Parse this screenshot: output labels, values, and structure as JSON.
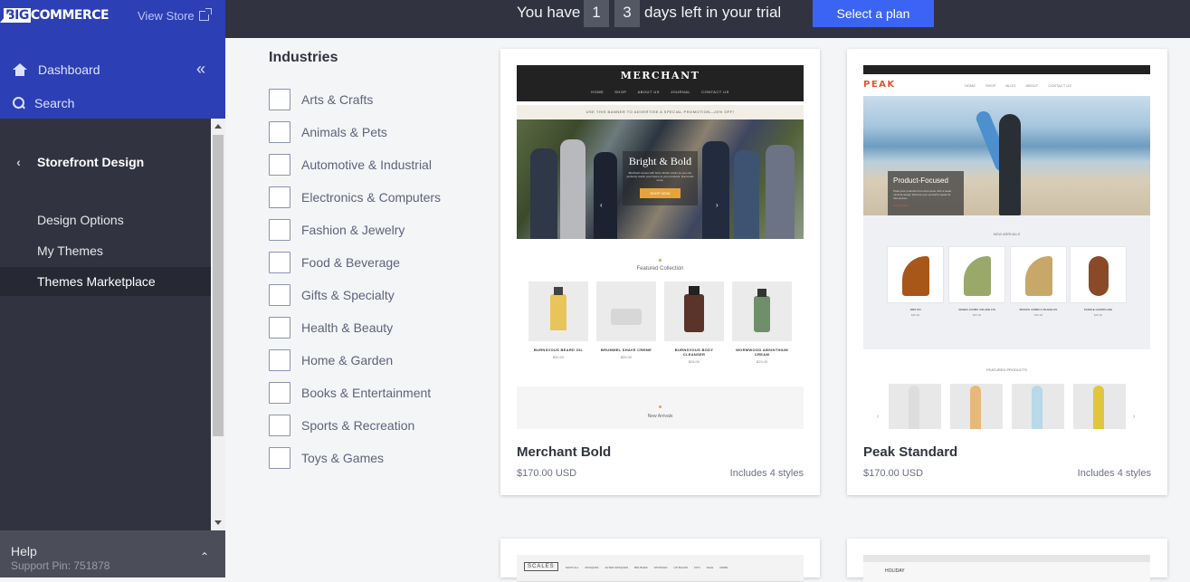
{
  "sidebar": {
    "logo_prefix": "BIG",
    "logo_suffix": "COMMERCE",
    "view_store": "View Store",
    "dashboard": "Dashboard",
    "search": "Search",
    "section": "Storefront Design",
    "links": [
      "Design Options",
      "My Themes",
      "Themes Marketplace"
    ],
    "active_link": "Themes Marketplace",
    "help": "Help",
    "support_pin": "Support Pin: 751878"
  },
  "trial": {
    "text_before": "You have",
    "digit1": "1",
    "digit2": "3",
    "text_after": "days left in your trial",
    "button": "Select a plan"
  },
  "filters": {
    "title": "Industries",
    "items": [
      "Arts & Crafts",
      "Animals & Pets",
      "Automotive & Industrial",
      "Electronics & Computers",
      "Fashion & Jewelry",
      "Food & Beverage",
      "Gifts & Specialty",
      "Health & Beauty",
      "Home & Garden",
      "Books & Entertainment",
      "Sports & Recreation",
      "Toys & Games"
    ]
  },
  "themes": [
    {
      "name": "Merchant Bold",
      "price": "$170.00 USD",
      "styles": "Includes 4 styles",
      "preview": {
        "logo": "MERCHANT",
        "nav": [
          "HOME",
          "SHOP",
          "ABOUT US",
          "JOURNAL",
          "CONTACT US"
        ],
        "promo": "USE THIS BANNER TO ADVERTISE A SPECIAL PROMOTION—20% OFF!",
        "hero_title": "Bright & Bold",
        "hero_sub": "Merchant comes with bold, vibrant colors so you can perfectly match your theme to your products, brand and more.",
        "hero_button": "SHOP NOW",
        "featured_title": "Featured Collection",
        "products": [
          {
            "name": "BURNSVOUS BEARD OIL",
            "price": "$30.00"
          },
          {
            "name": "BRUMMEL SHAVE CREME",
            "price": "$25.00"
          },
          {
            "name": "BURNSVOUS BODY CLEANSER",
            "price": "$28.00"
          },
          {
            "name": "WORMWOOD ABSINTHIUM CREAM",
            "price": "$29.40"
          }
        ],
        "arrivals_title": "New Arrivals"
      }
    },
    {
      "name": "Peak Standard",
      "price": "$170.00 USD",
      "styles": "Includes 4 styles",
      "preview": {
        "logo": "PEAK",
        "nav": [
          "HOME",
          "SHOP",
          "BLOG",
          "ABOUT",
          "CONTACT US"
        ],
        "hero_title": "Product-Focused",
        "hero_sub": "Peak puts products front and center with a sleek, minimal design that lets your products speak for themselves.",
        "hero_button": "SHOP NOW",
        "new_title": "NEW ARRIVALS",
        "products": [
          {
            "name": "1805 FIN",
            "price": "$20.00"
          },
          {
            "name": "GREEN JUMBO II BLADE FIN",
            "price": "$20.00"
          },
          {
            "name": "BROWN JUMBO II BLADE FIN",
            "price": "$20.00"
          },
          {
            "name": "PADDLE HANDPLANE",
            "price": "$20.00"
          }
        ],
        "featured_title": "FEATURED PRODUCTS"
      }
    },
    {
      "preview": {
        "logo": "SCALES",
        "nav": [
          "SHOP ALL",
          "MASQUES",
          "AFTER MASQUES",
          "BRUSHES",
          "SPONGES",
          "LIP BALMS",
          "KITS",
          "SALE",
          "MORE"
        ]
      }
    },
    {
      "preview": {
        "logo": "HOLIDAY"
      }
    }
  ],
  "colors": {
    "sidebar_bg": "#313440",
    "sidebar_top": "#2d3fb4",
    "accent_button": "#3c64f4",
    "page_bg": "#f4f5f7"
  }
}
